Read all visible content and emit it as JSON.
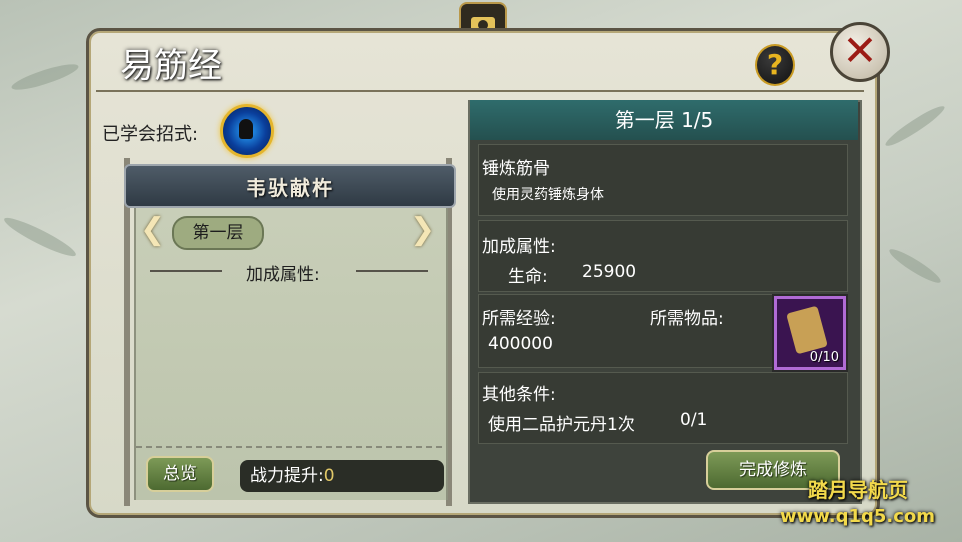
{
  "window": {
    "title": "易筋经"
  },
  "learned": {
    "label": "已学会招式:"
  },
  "skill": {
    "banner": "韦驮献杵"
  },
  "left": {
    "layer": "第一层",
    "attr_label": "加成属性:",
    "overview_button": "总览",
    "power_label": "战力提升:",
    "power_value": "0"
  },
  "right": {
    "header": "第一层  1/5",
    "section1_title": "锤炼筋骨",
    "section1_desc": "使用灵药锤炼身体",
    "attr_title": "加成属性:",
    "attr_name": "生命:",
    "attr_value": "25900",
    "exp_label": "所需经验:",
    "exp_value": "400000",
    "item_label": "所需物品:",
    "item_count": "0/10",
    "other_title": "其他条件:",
    "other_desc": "使用二品护元丹1次",
    "other_progress": "0/1",
    "complete_button": "完成修炼"
  },
  "icons": {
    "camera": "camera-icon",
    "help": "?",
    "close": "✕",
    "arrow_left": "❮",
    "arrow_right": "❯"
  },
  "watermark": {
    "line1": "踏月导航页",
    "line2": "www.q1q5.com"
  },
  "colors": {
    "header_teal": "#2f6c6c",
    "button_green": "#4d6a31",
    "item_purple": "#b16bd6",
    "watermark": "#f2d94b"
  }
}
